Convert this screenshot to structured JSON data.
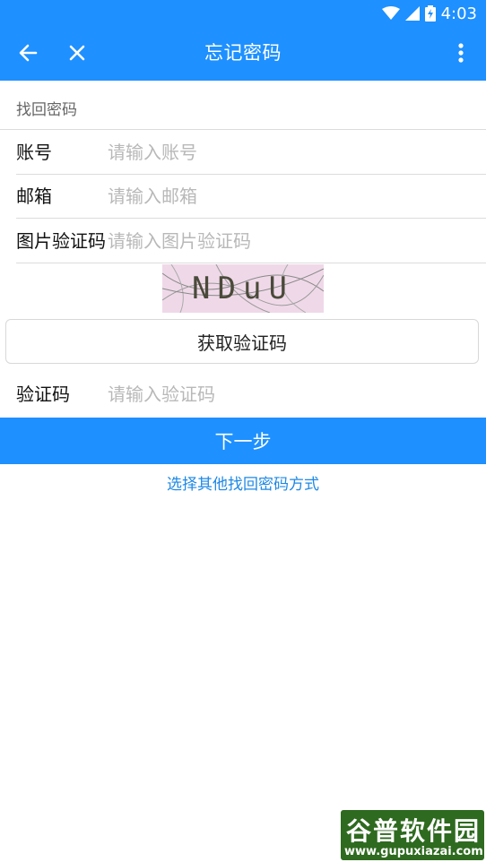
{
  "status_bar": {
    "time": "4:03"
  },
  "header": {
    "title": "忘记密码"
  },
  "section": {
    "title": "找回密码"
  },
  "form": {
    "account": {
      "label": "账号",
      "placeholder": "请输入账号"
    },
    "email": {
      "label": "邮箱",
      "placeholder": "请输入邮箱"
    },
    "image_captcha": {
      "label": "图片验证码",
      "placeholder": "请输入图片验证码",
      "captcha_text": "NDuU"
    },
    "get_code_button": "获取验证码",
    "code": {
      "label": "验证码",
      "placeholder": "请输入验证码"
    }
  },
  "next_button": "下一步",
  "other_method_link": "选择其他找回密码方式",
  "watermark": {
    "title": "谷普软件园",
    "url": "www.gupuxiazai.com"
  },
  "colors": {
    "primary": "#1e90ff",
    "link": "#1e88e5"
  }
}
